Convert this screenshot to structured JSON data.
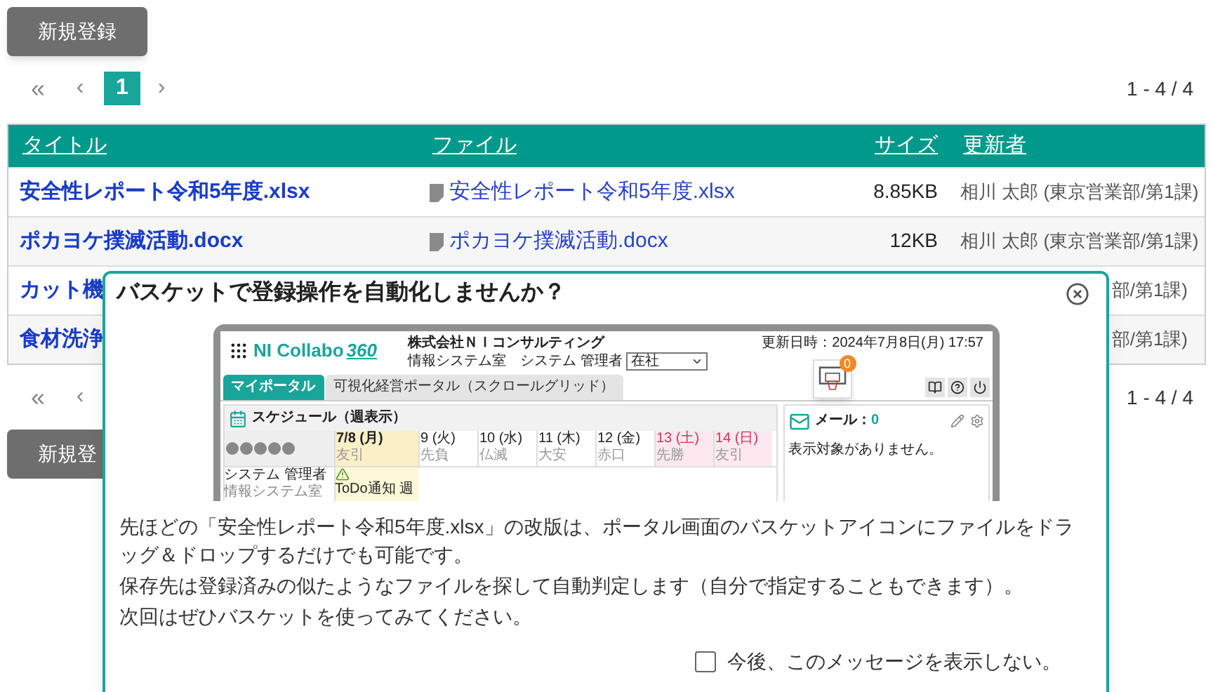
{
  "top_button": "新規登録",
  "pagination_top": {
    "first": "«",
    "prev": "‹",
    "pages": [
      {
        "label": "1",
        "selected": true
      }
    ],
    "next": "›",
    "range": "1 - 4 / 4"
  },
  "table": {
    "columns": [
      "タイトル",
      "ファイル",
      "サイズ",
      "更新者"
    ],
    "rows": [
      {
        "title": "安全性レポート令和5年度.xlsx",
        "file": "安全性レポート令和5年度.xlsx",
        "size": "8.85KB",
        "updater": "相川 太郎 (東京営業部/第1課)"
      },
      {
        "title": "ポカヨケ撲滅活動.docx",
        "file": "ポカヨケ撲滅活動.docx",
        "size": "12KB",
        "updater": "相川 太郎 (東京営業部/第1課)"
      },
      {
        "title": "カット機",
        "updater": "部/第1課)"
      },
      {
        "title": "食材洗浄",
        "updater": "部/第1課)"
      }
    ]
  },
  "pagination_bottom": {
    "first": "«",
    "prev": "‹",
    "range": "1 - 4 / 4"
  },
  "bottom_button": "新規登",
  "dialog": {
    "title": "バスケットで登録操作を自動化しませんか？",
    "screenshot": {
      "logo": "NI Collabo",
      "logo_number": "360",
      "company": "株式会社ＮＩコンサルティング",
      "user": "情報システム室　システム 管理者",
      "status": "在社",
      "updated": "更新日時：2024年7月8日(月) 17:57",
      "basket_badge": "0",
      "tabs": [
        {
          "label": "マイポータル",
          "selected": true
        },
        {
          "label": "可視化経営ポータル（スクロールグリッド）",
          "selected": false
        }
      ],
      "schedule_title": "スケジュール（週表示）",
      "days": [
        {
          "date": "7/8 (月)",
          "tag": "友引",
          "kind": "today"
        },
        {
          "date": "9 (火)",
          "tag": "先負",
          "kind": "weekday"
        },
        {
          "date": "10 (水)",
          "tag": "仏滅",
          "kind": "weekday"
        },
        {
          "date": "11 (木)",
          "tag": "大安",
          "kind": "weekday"
        },
        {
          "date": "12 (金)",
          "tag": "赤口",
          "kind": "weekday"
        },
        {
          "date": "13 (土)",
          "tag": "先勝",
          "kind": "holiday"
        },
        {
          "date": "14 (日)",
          "tag": "友引",
          "kind": "holiday"
        }
      ],
      "person_name": "システム 管理者",
      "person_dept": "情報システム室",
      "todo": "ToDo通知 週",
      "mail_label": "メール：",
      "mail_count": "0",
      "mail_empty": "表示対象がありません。"
    },
    "paragraphs": [
      "先ほどの「安全性レポート令和5年度.xlsx」の改版は、ポータル画面のバスケットアイコンにファイルをドラッグ＆ドロップするだけでも可能です。",
      "保存先は登録済みの似たようなファイルを探して自動判定します（自分で指定することもできます）。",
      "次回はぜひバスケットを使ってみてください。"
    ],
    "checkbox": {
      "label": "今後、このメッセージを表示しない。",
      "checked": false
    }
  }
}
